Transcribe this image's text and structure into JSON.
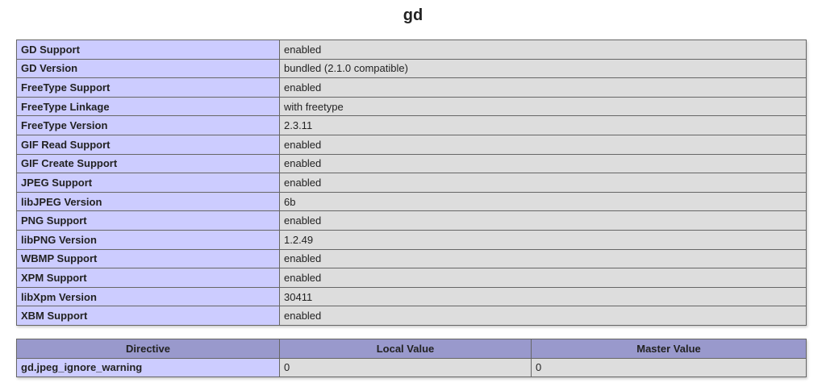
{
  "title": "gd",
  "info_rows": [
    {
      "label": "GD Support",
      "value": "enabled"
    },
    {
      "label": "GD Version",
      "value": "bundled (2.1.0 compatible)"
    },
    {
      "label": "FreeType Support",
      "value": "enabled"
    },
    {
      "label": "FreeType Linkage",
      "value": "with freetype"
    },
    {
      "label": "FreeType Version",
      "value": "2.3.11"
    },
    {
      "label": "GIF Read Support",
      "value": "enabled"
    },
    {
      "label": "GIF Create Support",
      "value": "enabled"
    },
    {
      "label": "JPEG Support",
      "value": "enabled"
    },
    {
      "label": "libJPEG Version",
      "value": "6b"
    },
    {
      "label": "PNG Support",
      "value": "enabled"
    },
    {
      "label": "libPNG Version",
      "value": "1.2.49"
    },
    {
      "label": "WBMP Support",
      "value": "enabled"
    },
    {
      "label": "XPM Support",
      "value": "enabled"
    },
    {
      "label": "libXpm Version",
      "value": "30411"
    },
    {
      "label": "XBM Support",
      "value": "enabled"
    }
  ],
  "directives": {
    "headers": [
      "Directive",
      "Local Value",
      "Master Value"
    ],
    "rows": [
      {
        "name": "gd.jpeg_ignore_warning",
        "local": "0",
        "master": "0"
      }
    ]
  }
}
